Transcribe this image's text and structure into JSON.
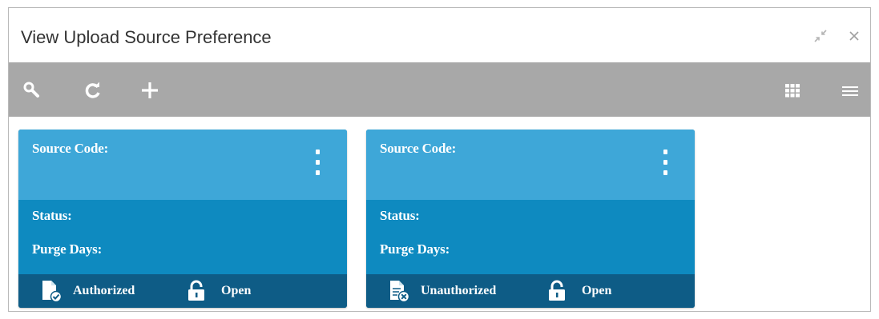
{
  "window": {
    "title": "View Upload Source Preference",
    "minimize_icon": "minimize-arrows-icon",
    "close_label": "×"
  },
  "toolbar": {
    "search_icon": "search-icon",
    "refresh_icon": "refresh-icon",
    "add_icon": "plus-icon",
    "grid_view_icon": "grid-view-icon",
    "list_view_icon": "list-view-icon"
  },
  "cards": [
    {
      "source_code_label": "Source Code:",
      "source_code_value": "",
      "status_label": "Status:",
      "purge_days_label": "Purge Days:",
      "auth_status": "Authorized",
      "auth_icon": "authorized-document-icon",
      "record_status": "Open",
      "record_icon": "unlocked-padlock-icon"
    },
    {
      "source_code_label": "Source Code:",
      "source_code_value": "",
      "status_label": "Status:",
      "purge_days_label": "Purge Days:",
      "auth_status": "Unauthorized",
      "auth_icon": "unauthorized-document-icon",
      "record_status": "Open",
      "record_icon": "unlocked-padlock-icon"
    }
  ],
  "colors": {
    "toolbar_bg": "#a8a8a8",
    "card_top": "#3ea7d8",
    "card_body": "#0e8ac0",
    "card_footer": "#0e5c86"
  }
}
